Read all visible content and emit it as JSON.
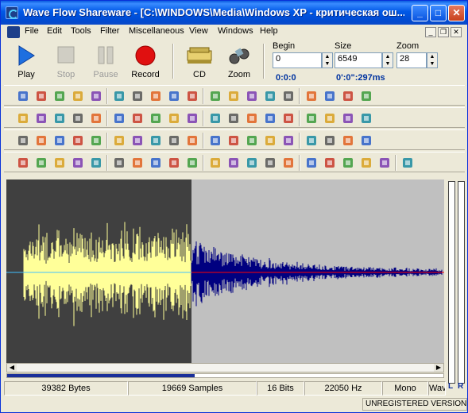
{
  "window": {
    "title": "Wave Flow Shareware - [C:\\WINDOWS\\Media\\Windows XP - критическая ош..."
  },
  "menu": [
    "File",
    "Edit",
    "Tools",
    "Filter",
    "Miscellaneous",
    "View",
    "Windows",
    "Help"
  ],
  "transport": {
    "play_label": "Play",
    "stop_label": "Stop",
    "pause_label": "Pause",
    "record_label": "Record",
    "cd_label": "CD",
    "zoom_label": "Zoom"
  },
  "range": {
    "begin_label": "Begin",
    "begin_value": "0",
    "begin_time": "0:0:0",
    "size_label": "Size",
    "size_value": "6549",
    "size_time": "0':0\":297ms",
    "zoom_label": "Zoom",
    "zoom_value": "28"
  },
  "toolbar_rows": [
    [
      "new-file-icon",
      "open-file-icon",
      "save-icon",
      "save-as-icon",
      "save-all-icon",
      "marker-icon",
      "info-icon",
      "properties-icon",
      "copy-selection-icon",
      "copy-to-new-icon",
      "paste-icon",
      "mix-icon",
      "print-icon",
      "close-file-icon",
      "close-all-icon",
      "exit-icon",
      "help-book-icon",
      "edit-pen-icon",
      "web-icon"
    ],
    [
      "cut-icon",
      "copy-icon",
      "paste-new-icon",
      "paste-mix-icon",
      "crop-icon",
      "delete-icon",
      "remove-silence-icon",
      "insert-silence-icon",
      "trim-icon",
      "select-all-icon",
      "deselect-icon",
      "undo-icon",
      "spectrum-icon",
      "frequency-analysis-icon",
      "sound-volume-icon",
      "speaker-icon",
      "zoom-in-icon",
      "zoom-out-icon",
      "find-icon"
    ],
    [
      "timer-icon",
      "swap-channels-icon",
      "reverse-icon",
      "invert-icon",
      "normalize-icon",
      "fade-in-icon",
      "fade-out-icon",
      "cross-fade-icon",
      "resample-icon",
      "shift-left-icon",
      "shift-right-icon",
      "amplify-icon",
      "volume-icon",
      "echo-icon",
      "effects-icon",
      "equalizer-icon",
      "envelope-icon",
      "markers-list-icon",
      "graph-icon"
    ],
    [
      "bar-analysis-icon",
      "grid-analysis-icon",
      "table-analysis-icon",
      "filter-1-icon",
      "filter-2-icon",
      "filter-3-icon",
      "filter-4-icon",
      "filter-5-icon",
      "filter-6-icon",
      "lowpass-icon",
      "highpass-icon",
      "bandpass-icon",
      "spectrum-1-icon",
      "spectrum-2-icon",
      "spectrum-3-icon",
      "spectrum-4-icon",
      "lightning-icon",
      "brush-icon",
      "mixer-sliders-icon",
      "magic-wand-icon",
      "checkmark-icon"
    ]
  ],
  "waveform": {
    "selection_end_fraction": 0.423,
    "colors": {
      "selected_bg": "#404040",
      "unselected_bg": "#c0c0c0",
      "selected_wave": "#ffff99",
      "unselected_wave": "#000080",
      "center_line_selected": "#40c0ff",
      "center_line_unselected": "#ff0000"
    }
  },
  "progress": {
    "fraction": 0.43
  },
  "status": {
    "bytes": "39382 Bytes",
    "samples": "19669 Samples",
    "bits": "16 Bits",
    "rate": "22050 Hz",
    "channels": "Mono",
    "extra": "Wave",
    "unregistered": "UNREGISTERED VERSION"
  },
  "meter": {
    "left_label": "L",
    "right_label": "R"
  }
}
